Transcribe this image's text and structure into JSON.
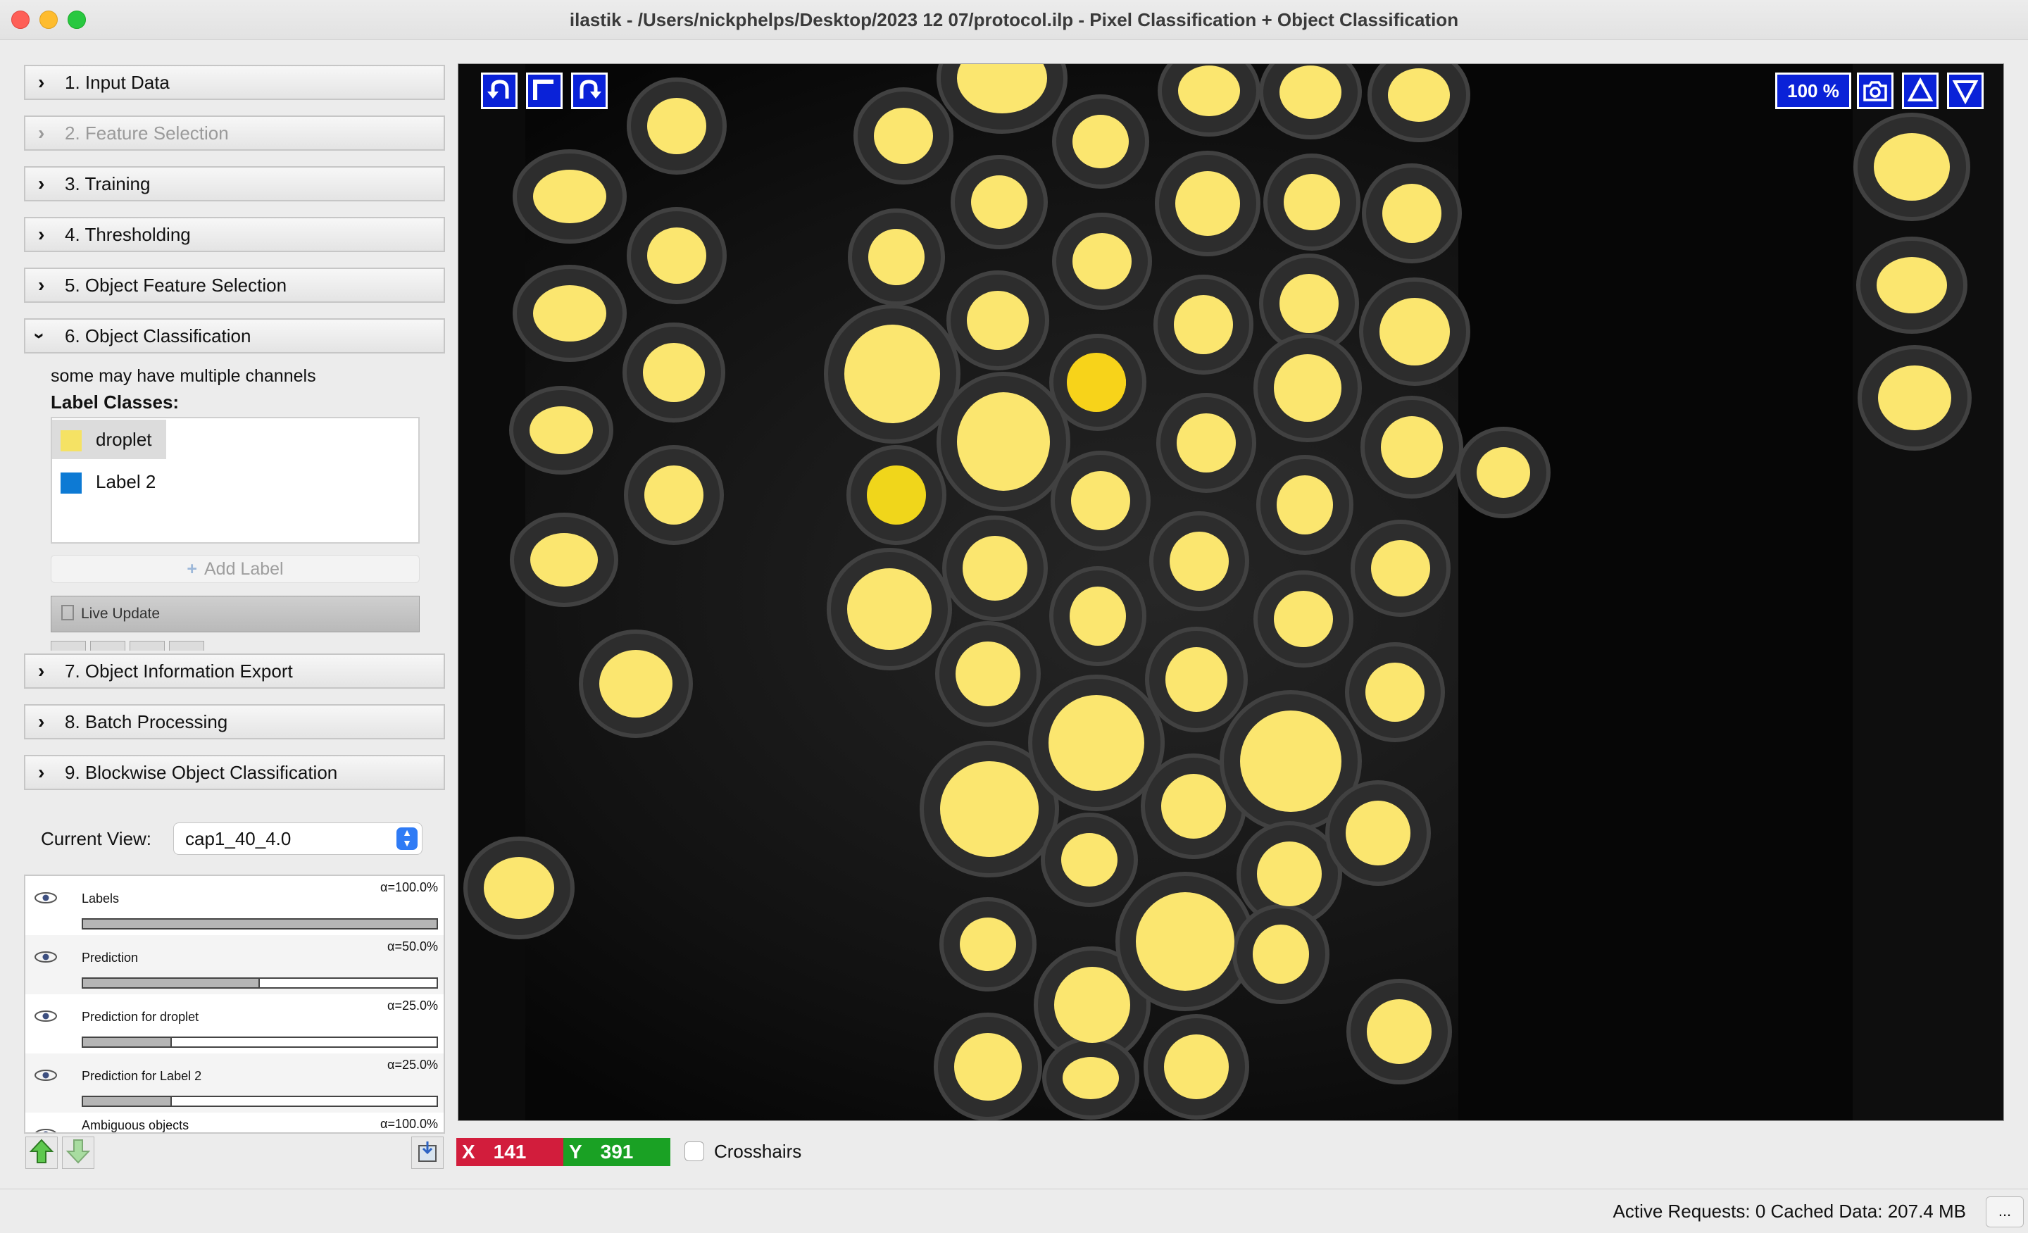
{
  "window": {
    "title": "ilastik - /Users/nickphelps/Desktop/2023 12 07/protocol.ilp - Pixel Classification + Object Classification"
  },
  "applets": [
    {
      "label": "1. Input Data",
      "enabled": true,
      "expanded": false
    },
    {
      "label": "2. Feature Selection",
      "enabled": false,
      "expanded": false
    },
    {
      "label": "3. Training",
      "enabled": true,
      "expanded": false
    },
    {
      "label": "4. Thresholding",
      "enabled": true,
      "expanded": false
    },
    {
      "label": "5. Object Feature Selection",
      "enabled": true,
      "expanded": false
    },
    {
      "label": "6. Object Classification",
      "enabled": true,
      "expanded": true
    },
    {
      "label": "7. Object Information Export",
      "enabled": true,
      "expanded": false
    },
    {
      "label": "8. Batch Processing",
      "enabled": true,
      "expanded": false
    },
    {
      "label": "9. Blockwise Object Classification",
      "enabled": true,
      "expanded": false
    }
  ],
  "object_classification": {
    "note": "some may have multiple channels",
    "label_classes_heading": "Label Classes:",
    "classes": [
      {
        "name": "droplet",
        "color": "#f5e264",
        "selected": true
      },
      {
        "name": "Label 2",
        "color": "#0d7ad4",
        "selected": false
      }
    ],
    "add_label": "Add Label",
    "live_update": "Live Update"
  },
  "current_view": {
    "label": "Current View:",
    "value": "cap1_40_4.0"
  },
  "layers": [
    {
      "name": "Labels",
      "alpha": "α=100.0%",
      "opacity": 1.0
    },
    {
      "name": "Prediction",
      "alpha": "α=50.0%",
      "opacity": 0.5
    },
    {
      "name": "Prediction for droplet",
      "alpha": "α=25.0%",
      "opacity": 0.25
    },
    {
      "name": "Prediction for Label 2",
      "alpha": "α=25.0%",
      "opacity": 0.25
    },
    {
      "name": "Ambiguous objects",
      "alpha": "α=100.0%",
      "opacity": 1.0
    }
  ],
  "viewer": {
    "zoom": "100 %",
    "icons": [
      "undo-icon",
      "fit-icon",
      "redo-icon",
      "camera-icon",
      "triangle-up-icon",
      "triangle-down-icon"
    ],
    "droplet_color": "#fbe66f"
  },
  "position": {
    "x_label": "X",
    "x_value": "141",
    "y_label": "Y",
    "y_value": "391",
    "crosshairs": "Crosshairs"
  },
  "status": {
    "text": "Active Requests: 0  Cached Data: 207.4 MB",
    "more": "..."
  }
}
